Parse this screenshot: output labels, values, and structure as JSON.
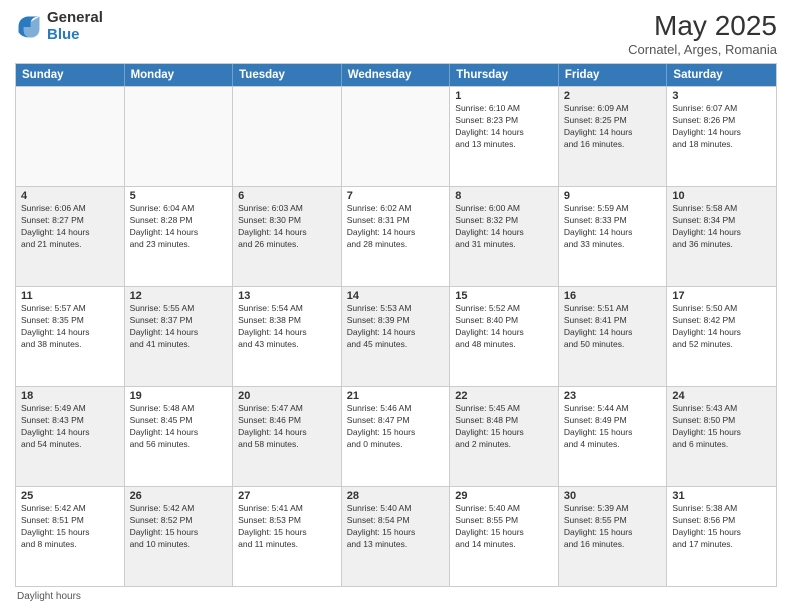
{
  "header": {
    "logo_general": "General",
    "logo_blue": "Blue",
    "title": "May 2025",
    "subtitle": "Cornatel, Arges, Romania"
  },
  "calendar": {
    "days_of_week": [
      "Sunday",
      "Monday",
      "Tuesday",
      "Wednesday",
      "Thursday",
      "Friday",
      "Saturday"
    ],
    "weeks": [
      [
        {
          "day": "",
          "info": "",
          "empty": true
        },
        {
          "day": "",
          "info": "",
          "empty": true
        },
        {
          "day": "",
          "info": "",
          "empty": true
        },
        {
          "day": "",
          "info": "",
          "empty": true
        },
        {
          "day": "1",
          "info": "Sunrise: 6:10 AM\nSunset: 8:23 PM\nDaylight: 14 hours\nand 13 minutes."
        },
        {
          "day": "2",
          "info": "Sunrise: 6:09 AM\nSunset: 8:25 PM\nDaylight: 14 hours\nand 16 minutes.",
          "shaded": true
        },
        {
          "day": "3",
          "info": "Sunrise: 6:07 AM\nSunset: 8:26 PM\nDaylight: 14 hours\nand 18 minutes."
        }
      ],
      [
        {
          "day": "4",
          "info": "Sunrise: 6:06 AM\nSunset: 8:27 PM\nDaylight: 14 hours\nand 21 minutes.",
          "shaded": true
        },
        {
          "day": "5",
          "info": "Sunrise: 6:04 AM\nSunset: 8:28 PM\nDaylight: 14 hours\nand 23 minutes."
        },
        {
          "day": "6",
          "info": "Sunrise: 6:03 AM\nSunset: 8:30 PM\nDaylight: 14 hours\nand 26 minutes.",
          "shaded": true
        },
        {
          "day": "7",
          "info": "Sunrise: 6:02 AM\nSunset: 8:31 PM\nDaylight: 14 hours\nand 28 minutes."
        },
        {
          "day": "8",
          "info": "Sunrise: 6:00 AM\nSunset: 8:32 PM\nDaylight: 14 hours\nand 31 minutes.",
          "shaded": true
        },
        {
          "day": "9",
          "info": "Sunrise: 5:59 AM\nSunset: 8:33 PM\nDaylight: 14 hours\nand 33 minutes."
        },
        {
          "day": "10",
          "info": "Sunrise: 5:58 AM\nSunset: 8:34 PM\nDaylight: 14 hours\nand 36 minutes.",
          "shaded": true
        }
      ],
      [
        {
          "day": "11",
          "info": "Sunrise: 5:57 AM\nSunset: 8:35 PM\nDaylight: 14 hours\nand 38 minutes."
        },
        {
          "day": "12",
          "info": "Sunrise: 5:55 AM\nSunset: 8:37 PM\nDaylight: 14 hours\nand 41 minutes.",
          "shaded": true
        },
        {
          "day": "13",
          "info": "Sunrise: 5:54 AM\nSunset: 8:38 PM\nDaylight: 14 hours\nand 43 minutes."
        },
        {
          "day": "14",
          "info": "Sunrise: 5:53 AM\nSunset: 8:39 PM\nDaylight: 14 hours\nand 45 minutes.",
          "shaded": true
        },
        {
          "day": "15",
          "info": "Sunrise: 5:52 AM\nSunset: 8:40 PM\nDaylight: 14 hours\nand 48 minutes."
        },
        {
          "day": "16",
          "info": "Sunrise: 5:51 AM\nSunset: 8:41 PM\nDaylight: 14 hours\nand 50 minutes.",
          "shaded": true
        },
        {
          "day": "17",
          "info": "Sunrise: 5:50 AM\nSunset: 8:42 PM\nDaylight: 14 hours\nand 52 minutes."
        }
      ],
      [
        {
          "day": "18",
          "info": "Sunrise: 5:49 AM\nSunset: 8:43 PM\nDaylight: 14 hours\nand 54 minutes.",
          "shaded": true
        },
        {
          "day": "19",
          "info": "Sunrise: 5:48 AM\nSunset: 8:45 PM\nDaylight: 14 hours\nand 56 minutes."
        },
        {
          "day": "20",
          "info": "Sunrise: 5:47 AM\nSunset: 8:46 PM\nDaylight: 14 hours\nand 58 minutes.",
          "shaded": true
        },
        {
          "day": "21",
          "info": "Sunrise: 5:46 AM\nSunset: 8:47 PM\nDaylight: 15 hours\nand 0 minutes."
        },
        {
          "day": "22",
          "info": "Sunrise: 5:45 AM\nSunset: 8:48 PM\nDaylight: 15 hours\nand 2 minutes.",
          "shaded": true
        },
        {
          "day": "23",
          "info": "Sunrise: 5:44 AM\nSunset: 8:49 PM\nDaylight: 15 hours\nand 4 minutes."
        },
        {
          "day": "24",
          "info": "Sunrise: 5:43 AM\nSunset: 8:50 PM\nDaylight: 15 hours\nand 6 minutes.",
          "shaded": true
        }
      ],
      [
        {
          "day": "25",
          "info": "Sunrise: 5:42 AM\nSunset: 8:51 PM\nDaylight: 15 hours\nand 8 minutes."
        },
        {
          "day": "26",
          "info": "Sunrise: 5:42 AM\nSunset: 8:52 PM\nDaylight: 15 hours\nand 10 minutes.",
          "shaded": true
        },
        {
          "day": "27",
          "info": "Sunrise: 5:41 AM\nSunset: 8:53 PM\nDaylight: 15 hours\nand 11 minutes."
        },
        {
          "day": "28",
          "info": "Sunrise: 5:40 AM\nSunset: 8:54 PM\nDaylight: 15 hours\nand 13 minutes.",
          "shaded": true
        },
        {
          "day": "29",
          "info": "Sunrise: 5:40 AM\nSunset: 8:55 PM\nDaylight: 15 hours\nand 14 minutes."
        },
        {
          "day": "30",
          "info": "Sunrise: 5:39 AM\nSunset: 8:55 PM\nDaylight: 15 hours\nand 16 minutes.",
          "shaded": true
        },
        {
          "day": "31",
          "info": "Sunrise: 5:38 AM\nSunset: 8:56 PM\nDaylight: 15 hours\nand 17 minutes."
        }
      ]
    ]
  },
  "footer": {
    "note": "Daylight hours"
  }
}
